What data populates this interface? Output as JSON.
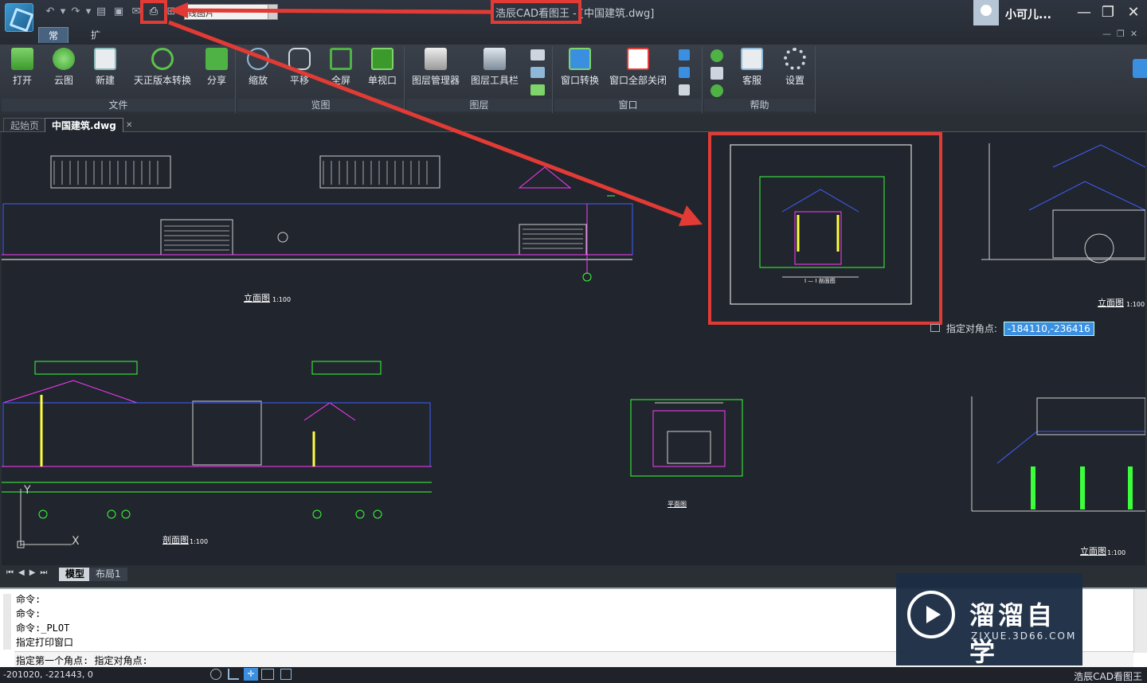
{
  "window": {
    "title": "浩辰CAD看图王 - [中国建筑.dwg]",
    "user_name": "小可儿...",
    "minimize": "—",
    "restore": "❐",
    "close": "✕"
  },
  "quick_access": {
    "dropdown_value": "线图片"
  },
  "ribbon": {
    "tabs": [
      "常用",
      "扩展工具"
    ],
    "groups": {
      "file": {
        "title": "文件",
        "buttons": [
          "打开",
          "云图",
          "新建",
          "天正版本转换",
          "分享"
        ]
      },
      "view": {
        "title": "览图",
        "buttons": [
          "缩放",
          "平移",
          "全屏",
          "单视口"
        ]
      },
      "layer": {
        "title": "图层",
        "buttons": [
          "图层管理器",
          "图层工具栏"
        ]
      },
      "window": {
        "title": "窗口",
        "buttons": [
          "窗口转换",
          "窗口全部关闭"
        ]
      },
      "help": {
        "title": "帮助",
        "buttons": [
          "客服",
          "设置"
        ]
      }
    }
  },
  "doc_tabs": [
    "起始页",
    "中国建筑.dwg"
  ],
  "canvas": {
    "labels": {
      "elevation1": "立面图",
      "elevation1_scale": "1:100",
      "section1": "剖面图",
      "section1_scale": "1:100",
      "section2": "I — I 剖面图",
      "plan": "平面图",
      "elevation_right1": "立面图",
      "elevation_right1_scale": "1:100",
      "elevation_right2": "立面图",
      "elevation_right2_scale": "1:100",
      "axis_labels": [
        "Y",
        "X"
      ]
    },
    "coord_tip": {
      "label": "指定对角点:",
      "value": "-184110,-236416"
    }
  },
  "layout_tabs": [
    "模型",
    "布局1"
  ],
  "command": {
    "lines": [
      "命令:",
      "命令:",
      "命令:_PLOT",
      "指定打印窗口"
    ],
    "input": "指定第一个角点: 指定对角点:"
  },
  "status": {
    "coords": "-201020, -221443, 0",
    "app": "浩辰CAD看图王"
  },
  "watermark": {
    "cn": "溜溜自学",
    "url": "ZIXUE.3D66.COM"
  },
  "colors": {
    "annotation_red": "#e23b35",
    "cad_bg": "#21252d",
    "ribbon_bg": "#3a404a"
  }
}
